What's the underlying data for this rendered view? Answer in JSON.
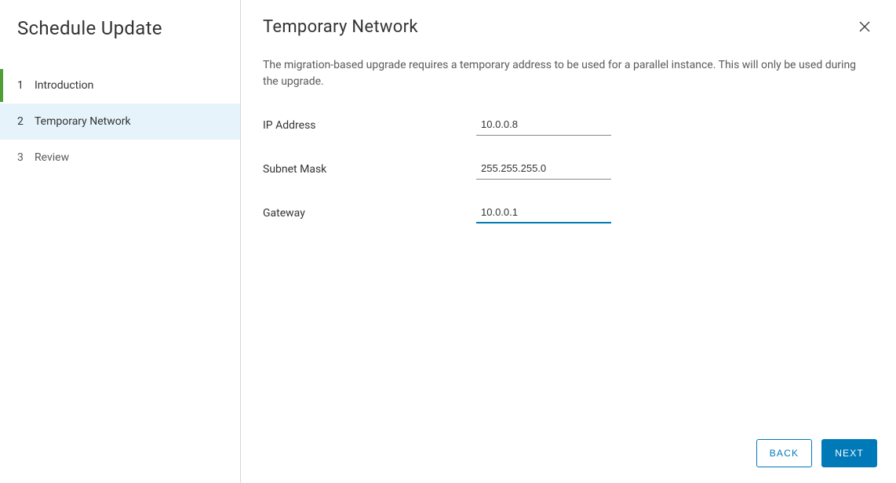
{
  "sidebar": {
    "title": "Schedule Update",
    "steps": [
      {
        "number": "1",
        "label": "Introduction"
      },
      {
        "number": "2",
        "label": "Temporary Network"
      },
      {
        "number": "3",
        "label": "Review"
      }
    ]
  },
  "main": {
    "title": "Temporary Network",
    "description": "The migration-based upgrade requires a temporary address to be used for a parallel instance. This will only be used during the upgrade.",
    "fields": {
      "ip_address": {
        "label": "IP Address",
        "value": "10.0.0.8"
      },
      "subnet_mask": {
        "label": "Subnet Mask",
        "value": "255.255.255.0"
      },
      "gateway": {
        "label": "Gateway",
        "value": "10.0.0.1"
      }
    }
  },
  "footer": {
    "back_label": "BACK",
    "next_label": "NEXT"
  }
}
